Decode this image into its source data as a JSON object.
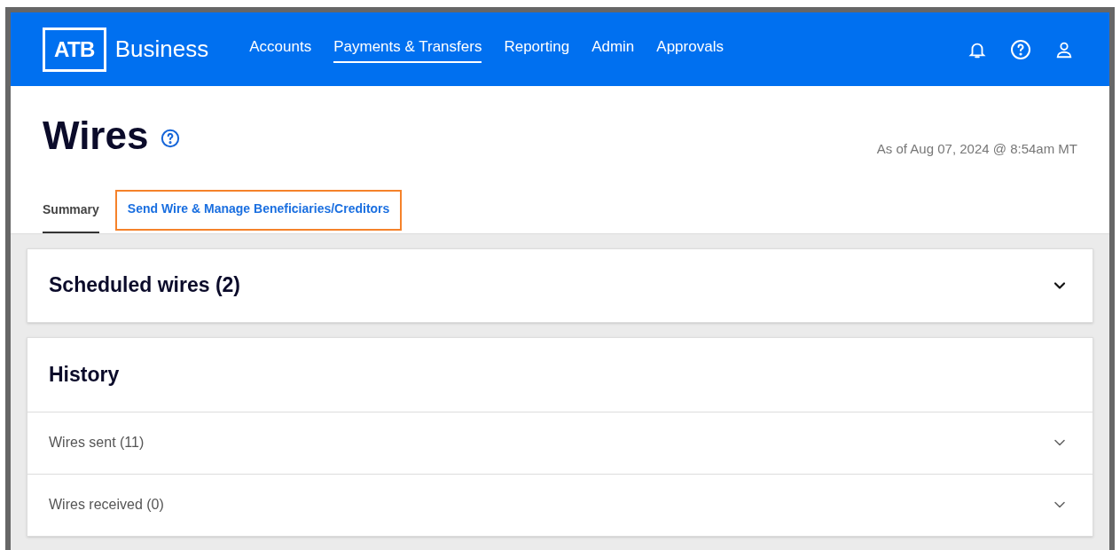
{
  "header": {
    "logo_mark": "ATB",
    "logo_text": "Business",
    "nav": [
      {
        "label": "Accounts",
        "selected": false
      },
      {
        "label": "Payments & Transfers",
        "selected": true
      },
      {
        "label": "Reporting",
        "selected": false
      },
      {
        "label": "Admin",
        "selected": false
      },
      {
        "label": "Approvals",
        "selected": false
      }
    ]
  },
  "page": {
    "title": "Wires",
    "timestamp": "As of Aug 07, 2024 @ 8:54am MT"
  },
  "tabs": [
    {
      "label": "Summary",
      "selected": true,
      "highlighted": false
    },
    {
      "label": "Send Wire & Manage Beneficiaries/Creditors",
      "selected": false,
      "highlighted": true
    }
  ],
  "scheduled": {
    "title": "Scheduled wires (2)",
    "expanded": false
  },
  "history": {
    "title": "History",
    "rows": [
      {
        "label": "Wires sent (11)",
        "expanded": false
      },
      {
        "label": "Wires received (0)",
        "expanded": false
      }
    ]
  }
}
